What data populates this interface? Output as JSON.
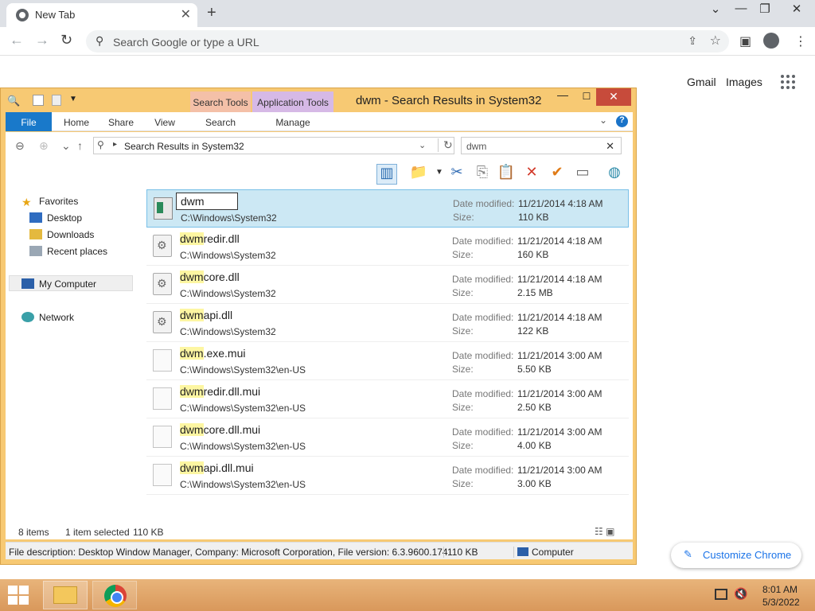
{
  "browser": {
    "tab_title": "New Tab",
    "omnibox_placeholder": "Search Google or type a URL",
    "links": {
      "gmail": "Gmail",
      "images": "Images"
    },
    "customize_label": "Customize Chrome"
  },
  "explorer": {
    "title": "dwm - Search Results in System32",
    "contextual_tabs": {
      "search_tools": "Search Tools",
      "application_tools": "Application Tools"
    },
    "ribbon_tabs": [
      "File",
      "Home",
      "Share",
      "View",
      "Search",
      "Manage"
    ],
    "address_path": "Search Results in System32",
    "search_query": "dwm",
    "nav": {
      "favorites": "Favorites",
      "desktop": "Desktop",
      "downloads": "Downloads",
      "recent_places": "Recent places",
      "my_computer": "My Computer",
      "network": "Network"
    },
    "meta_labels": {
      "date_modified": "Date modified:",
      "size": "Size:"
    },
    "files": [
      {
        "name_hl": "dwm",
        "name_rest": "",
        "path": "C:\\Windows\\System32",
        "date": "11/21/2014 4:18 AM",
        "size": "110 KB",
        "type": "exe",
        "selected": true,
        "rename_value": "dwm"
      },
      {
        "name_hl": "dwm",
        "name_rest": "redir.dll",
        "path": "C:\\Windows\\System32",
        "date": "11/21/2014 4:18 AM",
        "size": "160 KB",
        "type": "dll"
      },
      {
        "name_hl": "dwm",
        "name_rest": "core.dll",
        "path": "C:\\Windows\\System32",
        "date": "11/21/2014 4:18 AM",
        "size": "2.15 MB",
        "type": "dll"
      },
      {
        "name_hl": "dwm",
        "name_rest": "api.dll",
        "path": "C:\\Windows\\System32",
        "date": "11/21/2014 4:18 AM",
        "size": "122 KB",
        "type": "dll"
      },
      {
        "name_hl": "dwm",
        "name_rest": ".exe.mui",
        "path": "C:\\Windows\\System32\\en-US",
        "date": "11/21/2014 3:00 AM",
        "size": "5.50 KB",
        "type": "mui"
      },
      {
        "name_hl": "dwm",
        "name_rest": "redir.dll.mui",
        "path": "C:\\Windows\\System32\\en-US",
        "date": "11/21/2014 3:00 AM",
        "size": "2.50 KB",
        "type": "mui"
      },
      {
        "name_hl": "dwm",
        "name_rest": "core.dll.mui",
        "path": "C:\\Windows\\System32\\en-US",
        "date": "11/21/2014 3:00 AM",
        "size": "4.00 KB",
        "type": "mui"
      },
      {
        "name_hl": "dwm",
        "name_rest": "api.dll.mui",
        "path": "C:\\Windows\\System32\\en-US",
        "date": "11/21/2014 3:00 AM",
        "size": "3.00 KB",
        "type": "mui"
      }
    ],
    "status": {
      "item_count": "8 items",
      "selected": "1 item selected",
      "selected_size": "110 KB"
    },
    "details": {
      "description": "File description: Desktop Window Manager, Company: Microsoft Corporation, File version: 6.3.9600.174",
      "size": "110 KB",
      "location": "Computer"
    }
  },
  "taskbar": {
    "time": "8:01 AM",
    "date": "5/3/2022"
  },
  "colors": {
    "window_frame": "#f7c973",
    "selection": "#cce8f4",
    "file_tab": "#1979ca",
    "highlight": "#fdf6a2"
  }
}
